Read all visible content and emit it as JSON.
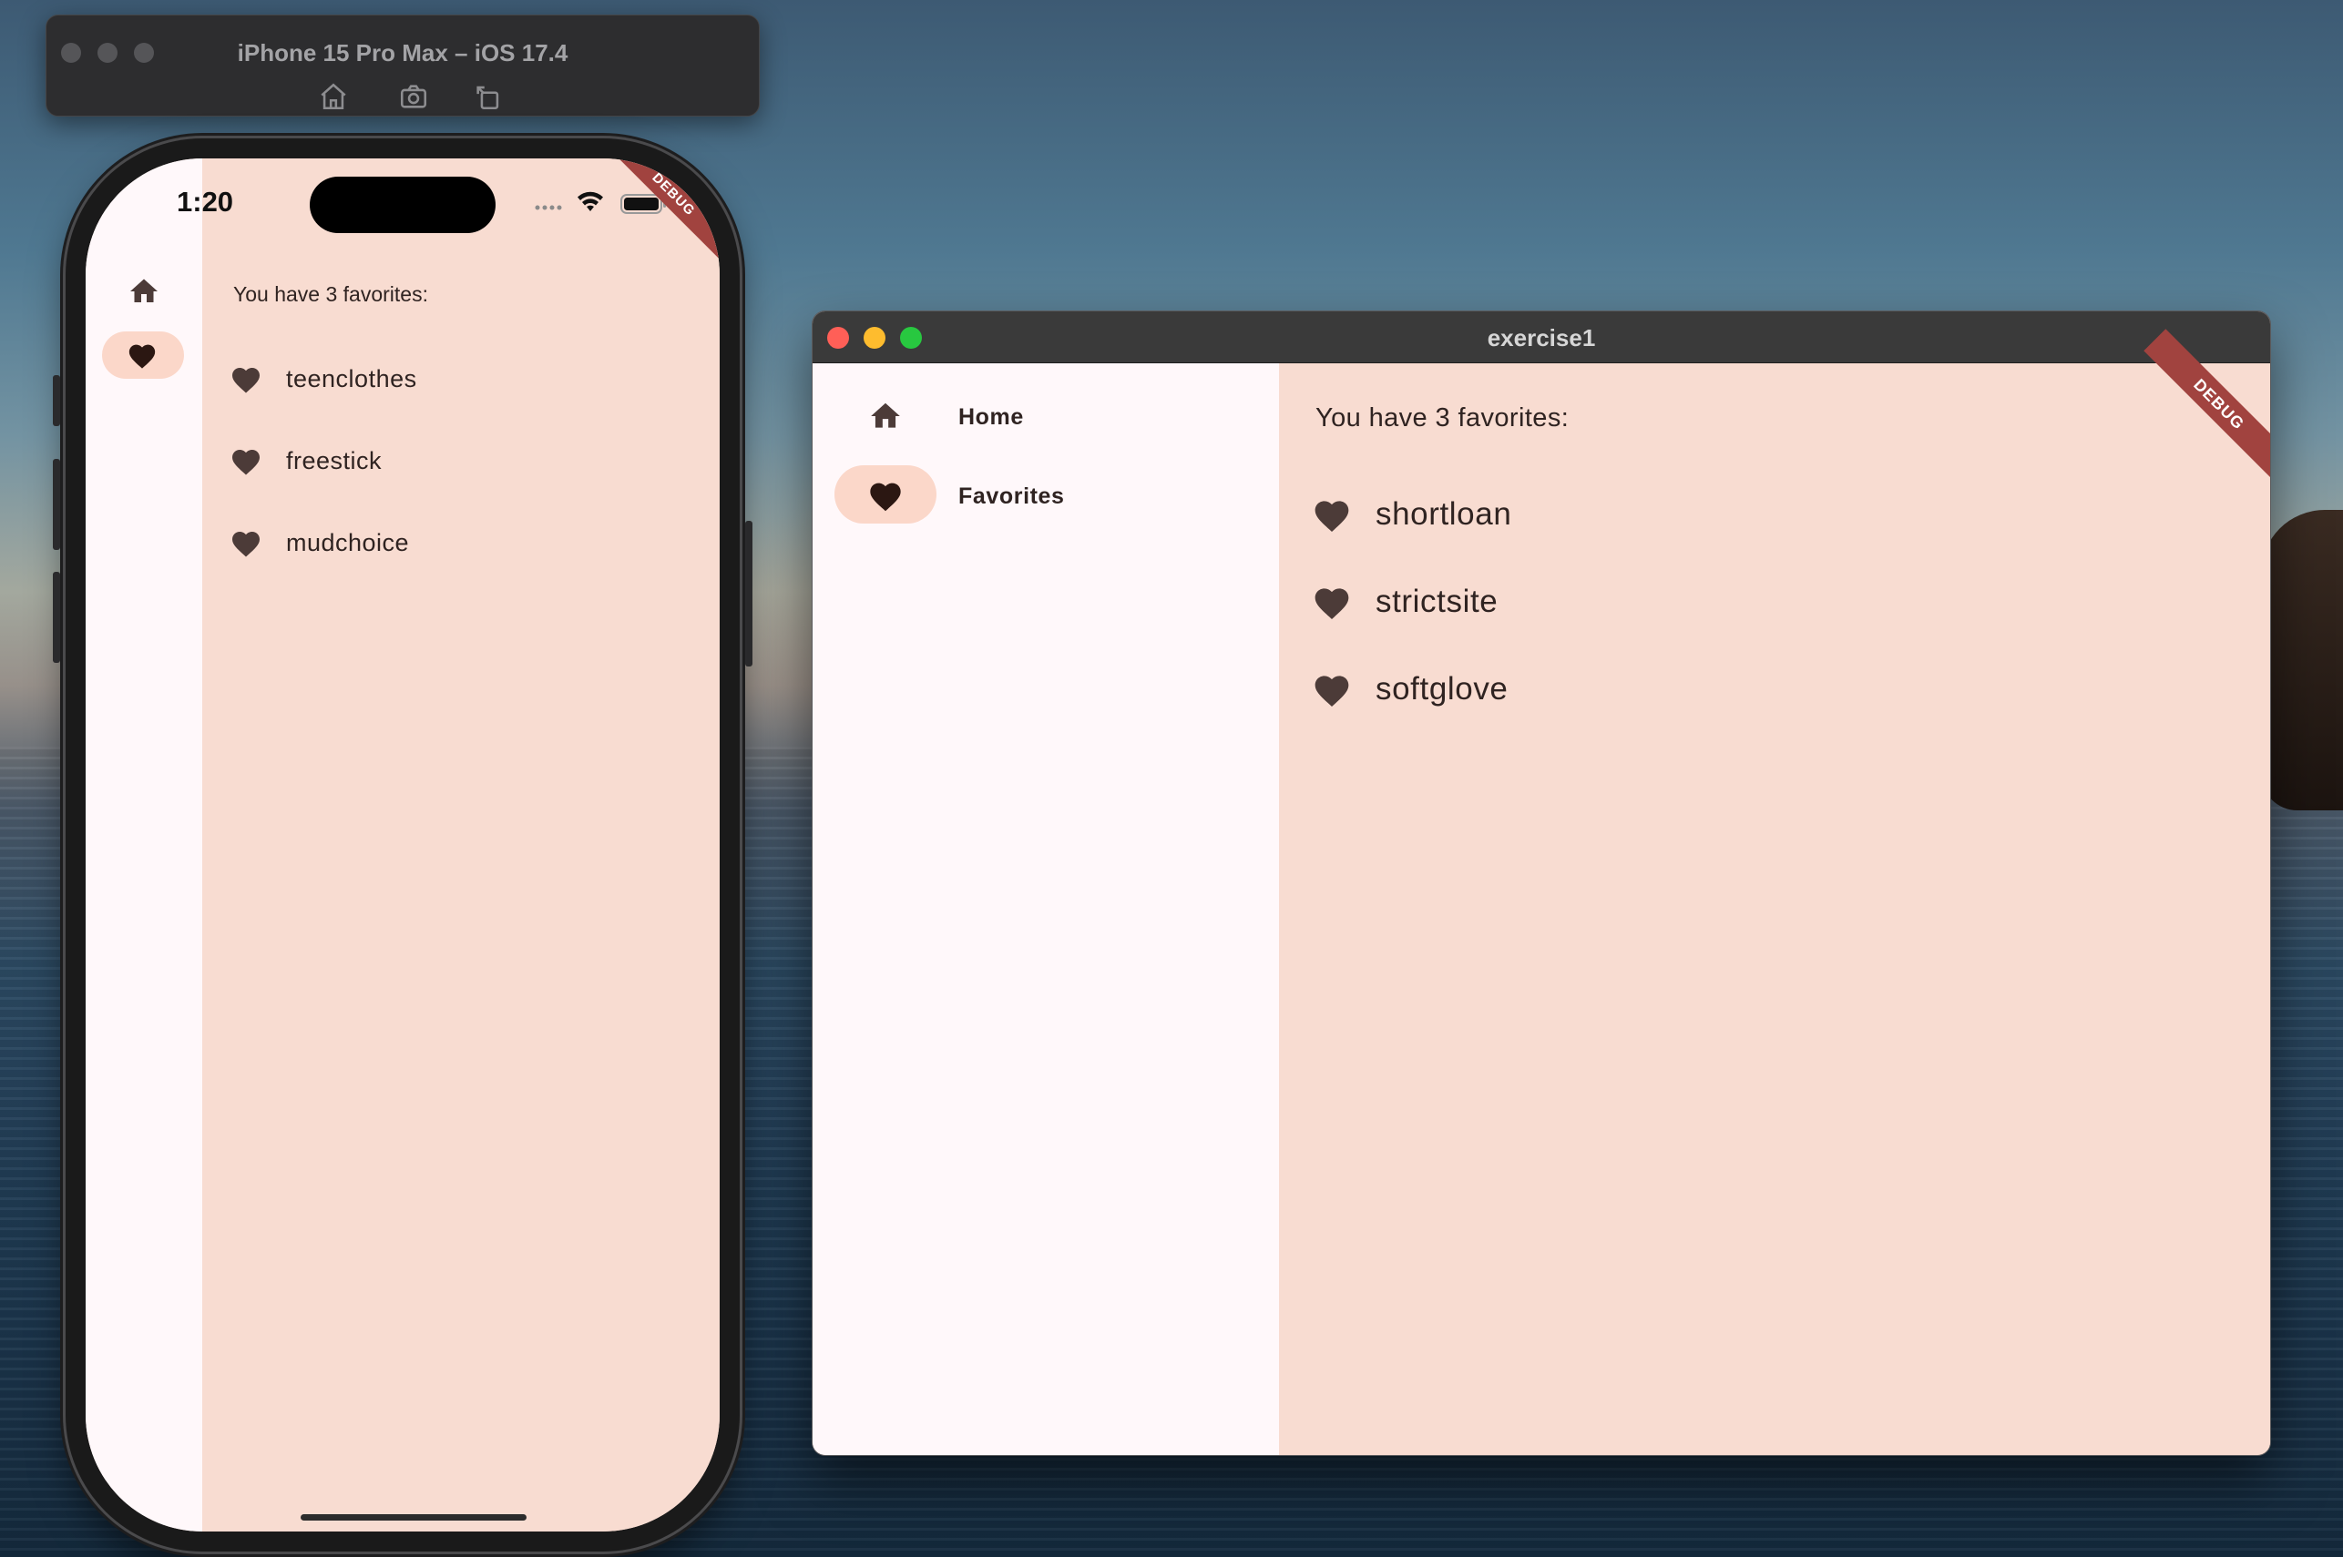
{
  "simulator": {
    "title": "iPhone 15 Pro Max – iOS 17.4",
    "buttons": [
      "home-icon",
      "screenshot-icon",
      "rotate-icon"
    ]
  },
  "phone_app": {
    "time": "1:20",
    "debug_banner": "DEBUG",
    "nav": [
      {
        "icon": "home-icon",
        "selected": false
      },
      {
        "icon": "heart-icon",
        "selected": true
      }
    ],
    "header": "You have 3 favorites:",
    "favorites": [
      "teenclothes",
      "freestick",
      "mudchoice"
    ]
  },
  "mac_app": {
    "title": "exercise1",
    "debug_banner": "DEBUG",
    "nav": [
      {
        "icon": "home-icon",
        "label": "Home",
        "selected": false
      },
      {
        "icon": "heart-icon",
        "label": "Favorites",
        "selected": true
      }
    ],
    "header": "You have 3 favorites:",
    "favorites": [
      "shortloan",
      "strictsite",
      "softglove"
    ]
  },
  "colors": {
    "rail_bg": "#fff8fa",
    "content_bg": "#f8dcd1",
    "selected_pill": "#fbd7c9",
    "icon": "#4c3b38",
    "text": "#2f2321",
    "debug_ribbon": "#a1433f",
    "close": "#ff5f57",
    "minimize": "#febc2e",
    "zoom": "#28c840"
  }
}
